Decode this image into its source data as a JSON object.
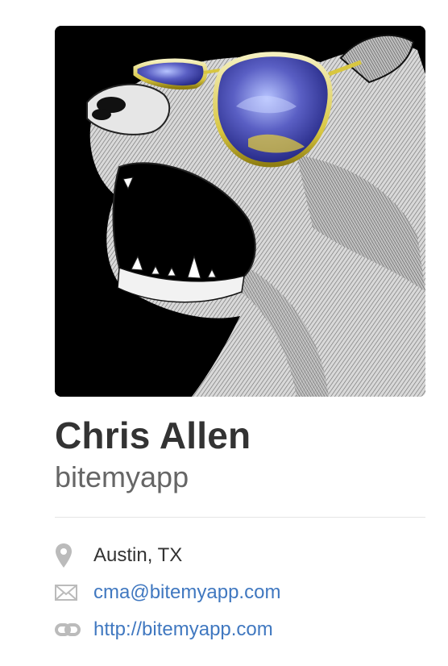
{
  "profile": {
    "avatar_alt": "bear wearing sunglasses",
    "fullname": "Chris Allen",
    "username": "bitemyapp",
    "details": {
      "location": {
        "icon": "location-pin-icon",
        "text": "Austin, TX"
      },
      "email": {
        "icon": "mail-icon",
        "text": "cma@bitemyapp.com"
      },
      "website": {
        "icon": "link-icon",
        "text": "http://bitemyapp.com"
      }
    },
    "colors": {
      "name": "#333333",
      "username": "#666666",
      "link": "#4078c0",
      "icon": "#bbbbbb"
    }
  }
}
